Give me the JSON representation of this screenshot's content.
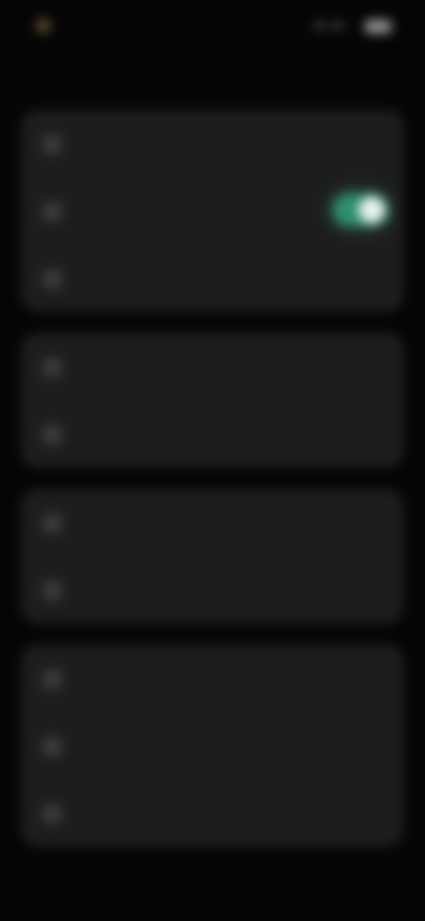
{
  "status_bar": {
    "time": "",
    "battery": ""
  },
  "header": {
    "title": ""
  },
  "groups": [
    {
      "rows": [
        {
          "label": "",
          "icon": "settings-icon"
        },
        {
          "label": "",
          "icon": "settings-icon",
          "toggle": true,
          "enabled": true
        },
        {
          "label": "",
          "icon": "settings-icon"
        }
      ]
    },
    {
      "rows": [
        {
          "label": "",
          "icon": "settings-icon"
        },
        {
          "label": "",
          "icon": "settings-icon"
        }
      ]
    },
    {
      "rows": [
        {
          "label": "",
          "icon": "settings-icon"
        },
        {
          "label": "",
          "icon": "settings-icon"
        }
      ]
    },
    {
      "rows": [
        {
          "label": "",
          "icon": "settings-icon"
        },
        {
          "label": "",
          "icon": "settings-icon"
        },
        {
          "label": "",
          "icon": "settings-icon"
        }
      ]
    }
  ],
  "colors": {
    "background": "#050505",
    "group_background": "#1d1d1f",
    "toggle_on": "#2f8f6d",
    "toggle_knob": "#e8f4ef"
  }
}
